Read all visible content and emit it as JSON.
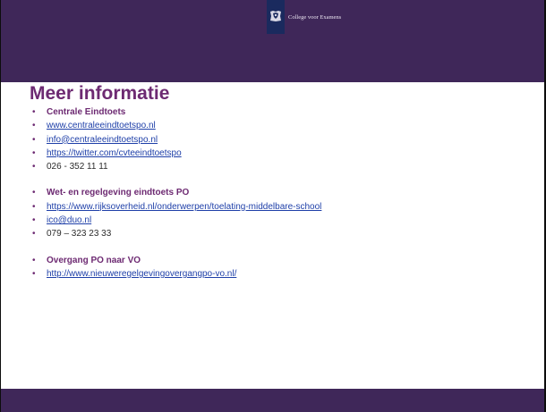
{
  "header": {
    "brand": "College voor Examens"
  },
  "title": "Meer informatie",
  "sections": [
    {
      "heading": "Centrale Eindtoets",
      "items": [
        {
          "text": "www.centraleeindtoetspo.nl",
          "link": true
        },
        {
          "text": "info@centraleeindtoetspo.nl",
          "link": true
        },
        {
          "text": "https://twitter.com/cvteeindtoetspo",
          "link": true
        },
        {
          "text": "026 - 352 11 11",
          "link": false
        }
      ]
    },
    {
      "heading": "Wet- en regelgeving eindtoets PO",
      "items": [
        {
          "text": "https://www.rijksoverheid.nl/onderwerpen/toelating-middelbare-school",
          "link": true
        },
        {
          "text": "ico@duo.nl",
          "link": true
        },
        {
          "text": "079 – 323 23 33",
          "link": false
        }
      ]
    },
    {
      "heading": "Overgang PO naar VO",
      "items": [
        {
          "text": "http://www.nieuweregelgevingovergangpo-vo.nl/",
          "link": true
        }
      ]
    }
  ],
  "colors": {
    "header": "#3f2759",
    "title": "#6d2a72",
    "link": "#1e3fa8",
    "logo": "#1a2a5e"
  },
  "icons": {
    "logo": "rijksoverheid-emblem-icon",
    "bullet": "bullet-icon"
  }
}
